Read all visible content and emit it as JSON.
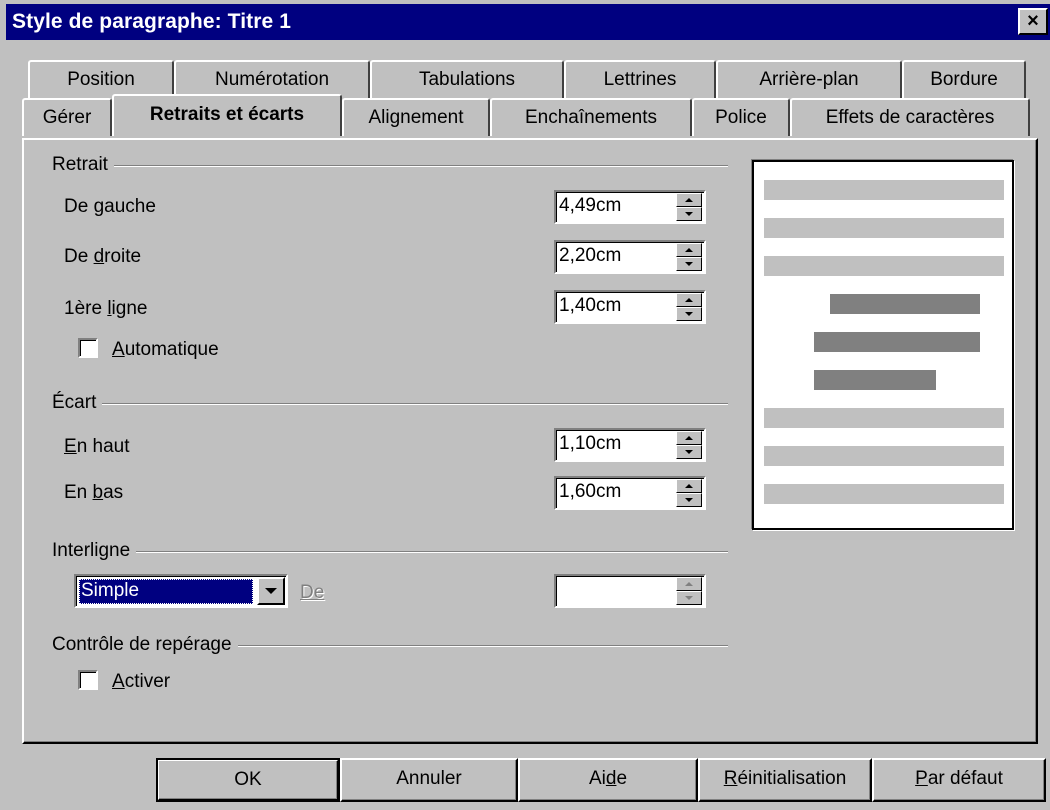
{
  "window": {
    "title": "Style de paragraphe: Titre 1",
    "close_label": "×"
  },
  "tabs_back": [
    {
      "label": "Position"
    },
    {
      "label": "Numérotation"
    },
    {
      "label": "Tabulations"
    },
    {
      "label": "Lettrines"
    },
    {
      "label": "Arrière-plan"
    },
    {
      "label": "Bordure"
    }
  ],
  "tabs_front": [
    {
      "label": "Gérer"
    },
    {
      "label": "Retraits et écarts",
      "active": true
    },
    {
      "label": "Alignement"
    },
    {
      "label": "Enchaînements"
    },
    {
      "label": "Police"
    },
    {
      "label": "Effets de caractères"
    }
  ],
  "retrait": {
    "title": "Retrait",
    "left_label_pre": "De ",
    "left_label_key": "g",
    "left_label_post": "auche",
    "left_value": "4,49cm",
    "right_label_pre": "De ",
    "right_label_key": "d",
    "right_label_post": "roite",
    "right_value": "2,20cm",
    "first_label_pre": "1ère ",
    "first_label_key": "l",
    "first_label_post": "igne",
    "first_value": "1,40cm",
    "auto_key": "A",
    "auto_post": "utomatique",
    "auto_checked": false
  },
  "ecart": {
    "title": "Écart",
    "top_key": "E",
    "top_post": "n haut",
    "top_value": "1,10cm",
    "bottom_pre": "En ",
    "bottom_key": "b",
    "bottom_post": "as",
    "bottom_value": "1,60cm"
  },
  "interligne": {
    "title": "Interligne",
    "selected": "Simple",
    "de_label": "De",
    "de_value": ""
  },
  "reperage": {
    "title": "Contrôle de repérage",
    "activate_key": "A",
    "activate_post": "ctiver",
    "checked": false
  },
  "buttons": {
    "ok": "OK",
    "cancel": "Annuler",
    "help_pre": "Ai",
    "help_key": "d",
    "help_post": "e",
    "reset_key": "R",
    "reset_post": "éinitialisation",
    "default_key": "P",
    "default_post": "ar défaut"
  },
  "colors": {
    "titlebar": "#000080",
    "face": "#c0c0c0",
    "preview_dark": "#808080",
    "preview_light": "#c0c0c0"
  }
}
